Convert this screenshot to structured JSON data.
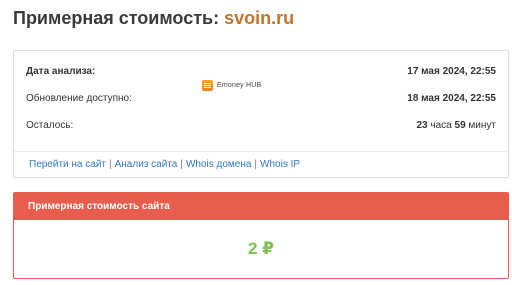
{
  "header": {
    "title_prefix": "Примерная стоимость:",
    "domain": "svoin.ru"
  },
  "info": {
    "rows": [
      {
        "label": "Дата анализа:",
        "value": "17 мая 2024, 22:55"
      },
      {
        "label": "Обновление доступно:",
        "value": "18 мая 2024, 22:55"
      },
      {
        "label": "Осталось:",
        "hours": "23",
        "hours_unit": "часа",
        "minutes": "59",
        "minutes_unit": "минут"
      }
    ],
    "links": [
      "Перейти на сайт",
      "Анализ сайта",
      "Whois домена",
      "Whois IP"
    ],
    "separator": "|"
  },
  "watermark": {
    "text": "Emoney HUB"
  },
  "value_card": {
    "header": "Примерная стоимость сайта",
    "amount": "2 ₽"
  },
  "colors": {
    "domain": "#c0732e",
    "link": "#3478c6",
    "value_header_bg": "#e95d4e",
    "amount": "#7dbf52"
  }
}
